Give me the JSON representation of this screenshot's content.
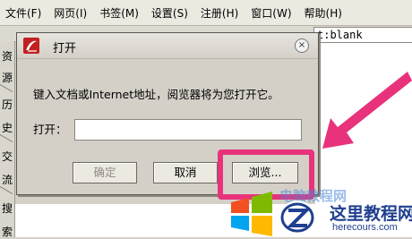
{
  "menu": [
    "文件(F)",
    "网页(I)",
    "书签(M)",
    "设置(S)",
    "注册(H)",
    "窗口(W)",
    "帮助(H)"
  ],
  "address": {
    "value": "t:blank"
  },
  "side_panel": {
    "labels": [
      "资",
      "源",
      "历",
      "史",
      "交",
      "流",
      "搜",
      "索"
    ]
  },
  "dialog": {
    "title": "打开",
    "close_glyph": "×",
    "prompt": "键入文档或Internet地址，阅览器将为您打开它。",
    "open_label": "打开：",
    "open_value": "",
    "buttons": {
      "ok": "确定",
      "cancel": "取消",
      "browse": "浏览..."
    }
  },
  "watermark": {
    "faint_text": "电脑教程网",
    "title": "这里教程网",
    "url": "herecours.com"
  },
  "colors": {
    "highlight": "#e8327c",
    "watermark_blue": "#1f3f8f"
  }
}
